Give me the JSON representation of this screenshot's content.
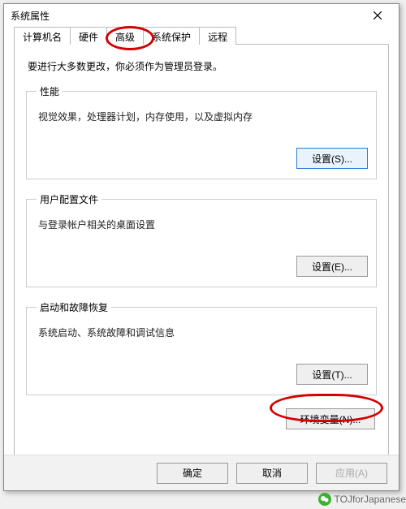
{
  "window": {
    "title": "系统属性"
  },
  "tabs": [
    {
      "label": "计算机名"
    },
    {
      "label": "硬件"
    },
    {
      "label": "高级"
    },
    {
      "label": "系统保护"
    },
    {
      "label": "远程"
    }
  ],
  "active_tab": "高级",
  "advanced": {
    "admin_note": "要进行大多数更改，你必须作为管理员登录。",
    "performance": {
      "legend": "性能",
      "desc": "视觉效果，处理器计划，内存使用，以及虚拟内存",
      "button": "设置(S)..."
    },
    "user_profiles": {
      "legend": "用户配置文件",
      "desc": "与登录帐户相关的桌面设置",
      "button": "设置(E)..."
    },
    "startup": {
      "legend": "启动和故障恢复",
      "desc": "系统启动、系统故障和调试信息",
      "button": "设置(T)..."
    },
    "env_button": "环境变量(N)..."
  },
  "dialog_buttons": {
    "ok": "确定",
    "cancel": "取消",
    "apply": "应用(A)"
  },
  "footer": {
    "label": "TOJforJapanese"
  }
}
